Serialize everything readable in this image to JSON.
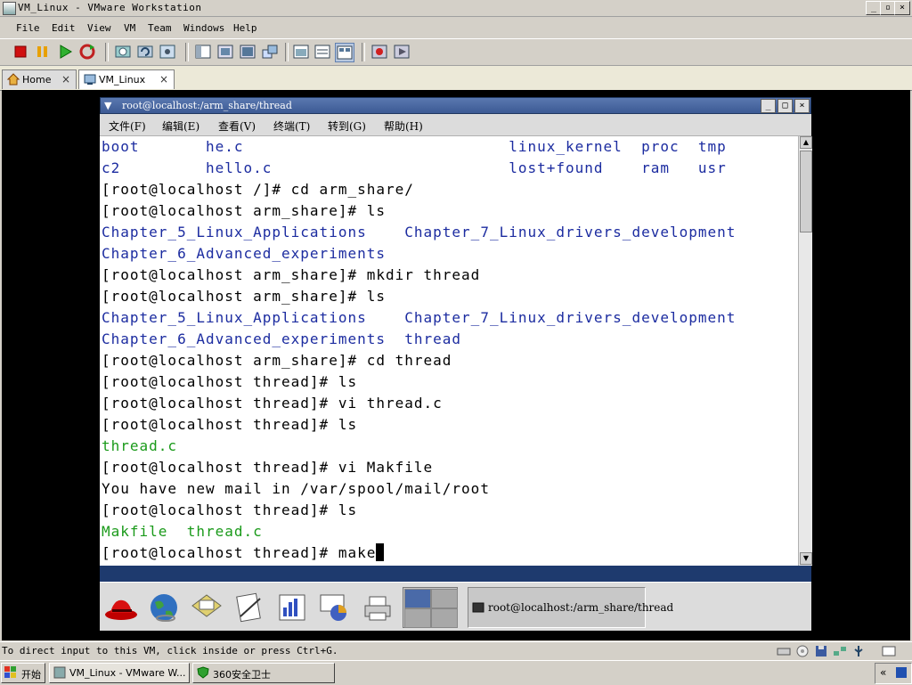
{
  "window": {
    "title": "VM_Linux - VMware Workstation",
    "controls": [
      "_",
      "▫",
      "×"
    ]
  },
  "menu": [
    "File",
    "Edit",
    "View",
    "VM",
    "Team",
    "Windows",
    "Help"
  ],
  "tabs": [
    {
      "label": "Home",
      "close": "×"
    },
    {
      "label": "VM_Linux",
      "close": "×"
    }
  ],
  "guest": {
    "terminal_title": "root@localhost:/arm_share/thread",
    "terminal_menu": [
      "文件(F)",
      "编辑(E)",
      "查看(V)",
      "终端(T)",
      "转到(G)",
      "帮助(H)"
    ],
    "lines": [
      [
        {
          "t": "boot       he.c                            ",
          "c": "blue"
        },
        {
          "t": "linux_kernel  proc  tmp",
          "c": "blue"
        }
      ],
      [
        {
          "t": "c2         hello.c                         ",
          "c": "blue"
        },
        {
          "t": "lost+found    ram   usr",
          "c": "blue"
        }
      ],
      [
        {
          "t": "[root@localhost /]# cd arm_share/",
          "c": ""
        }
      ],
      [
        {
          "t": "[root@localhost arm_share]# ls",
          "c": ""
        }
      ],
      [
        {
          "t": "Chapter_5_Linux_Applications    Chapter_7_Linux_drivers_development",
          "c": "blue"
        }
      ],
      [
        {
          "t": "Chapter_6_Advanced_experiments",
          "c": "blue"
        }
      ],
      [
        {
          "t": "[root@localhost arm_share]# mkdir thread",
          "c": ""
        }
      ],
      [
        {
          "t": "[root@localhost arm_share]# ls",
          "c": ""
        }
      ],
      [
        {
          "t": "Chapter_5_Linux_Applications    Chapter_7_Linux_drivers_development",
          "c": "blue"
        }
      ],
      [
        {
          "t": "Chapter_6_Advanced_experiments  thread",
          "c": "blue"
        }
      ],
      [
        {
          "t": "[root@localhost arm_share]# cd thread",
          "c": ""
        }
      ],
      [
        {
          "t": "[root@localhost thread]# ls",
          "c": ""
        }
      ],
      [
        {
          "t": "[root@localhost thread]# vi thread.c",
          "c": ""
        }
      ],
      [
        {
          "t": "[root@localhost thread]# ls",
          "c": ""
        }
      ],
      [
        {
          "t": "thread.c",
          "c": "green"
        }
      ],
      [
        {
          "t": "[root@localhost thread]# vi Makfile",
          "c": ""
        }
      ],
      [
        {
          "t": "You have new mail in /var/spool/mail/root",
          "c": ""
        }
      ],
      [
        {
          "t": "[root@localhost thread]# ls",
          "c": ""
        }
      ],
      [
        {
          "t": "Makfile  thread.c",
          "c": "green"
        }
      ],
      [
        {
          "t": "[root@localhost thread]# make",
          "c": "",
          "cursor": true
        }
      ]
    ],
    "task_label": "root@localhost:/arm_share/thread"
  },
  "status": {
    "text": "To direct input to this VM, click inside or press Ctrl+G."
  },
  "taskbar": {
    "start": "开始",
    "items": [
      "VM_Linux - VMware W...",
      "360安全卫士"
    ],
    "tray": "«"
  },
  "colors": {
    "terminal_blue": "#1c2ca0",
    "terminal_green": "#1a9a1a",
    "guest_title": "#3c5a94"
  }
}
